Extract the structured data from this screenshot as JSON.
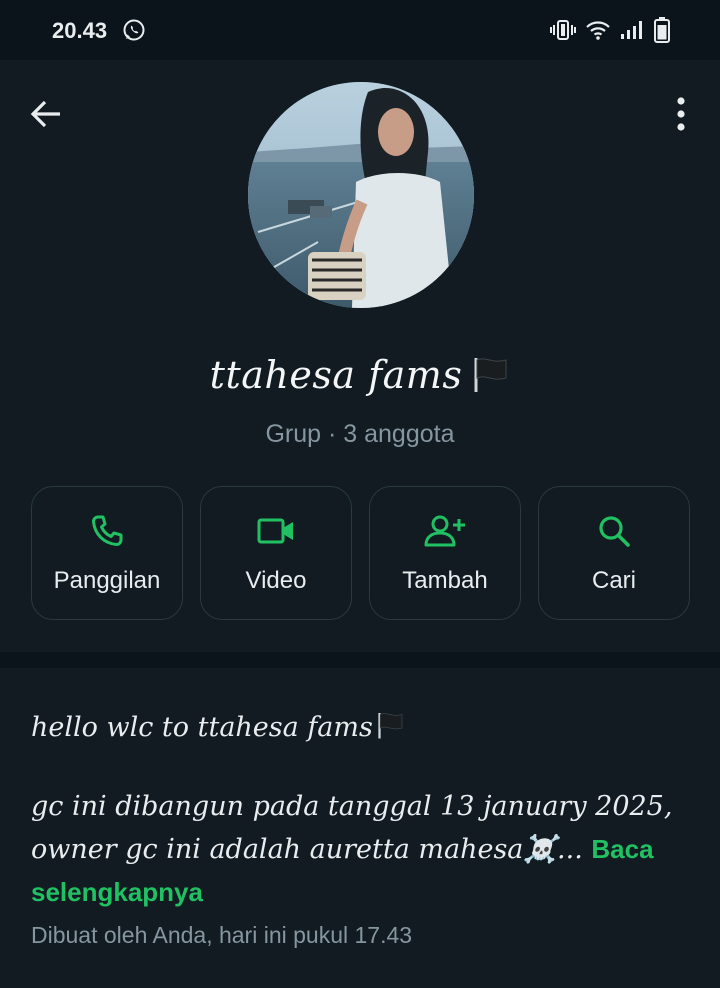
{
  "status_bar": {
    "time": "20.43",
    "icons": [
      "whatsapp-icon",
      "vibrate-icon",
      "wifi-icon",
      "signal-icon",
      "battery-icon"
    ]
  },
  "header": {
    "back_icon": "arrow-left-icon",
    "menu_icon": "more-vertical-icon"
  },
  "group": {
    "name": "ttahesa fams",
    "name_emoji": "black-flag",
    "subtitle": "Grup · 3 anggota"
  },
  "actions": [
    {
      "label": "Panggilan",
      "icon": "phone-icon"
    },
    {
      "label": "Video",
      "icon": "video-icon"
    },
    {
      "label": "Tambah",
      "icon": "add-person-icon"
    },
    {
      "label": "Cari",
      "icon": "search-icon"
    }
  ],
  "description": {
    "line1": "hello wlc to ttahesa fams",
    "body": "gc ini dibangun pada tanggal 13 january 2025, owner gc ini adalah auretta mahesa☠️...",
    "read_more": "Baca selengkapnya",
    "created": "Dibuat oleh Anda, hari ini pukul 17.43"
  },
  "colors": {
    "background": "#0b141a",
    "panel": "#111b21",
    "accent": "#21c063",
    "muted_text": "#8696a0",
    "text": "#e9edef"
  }
}
